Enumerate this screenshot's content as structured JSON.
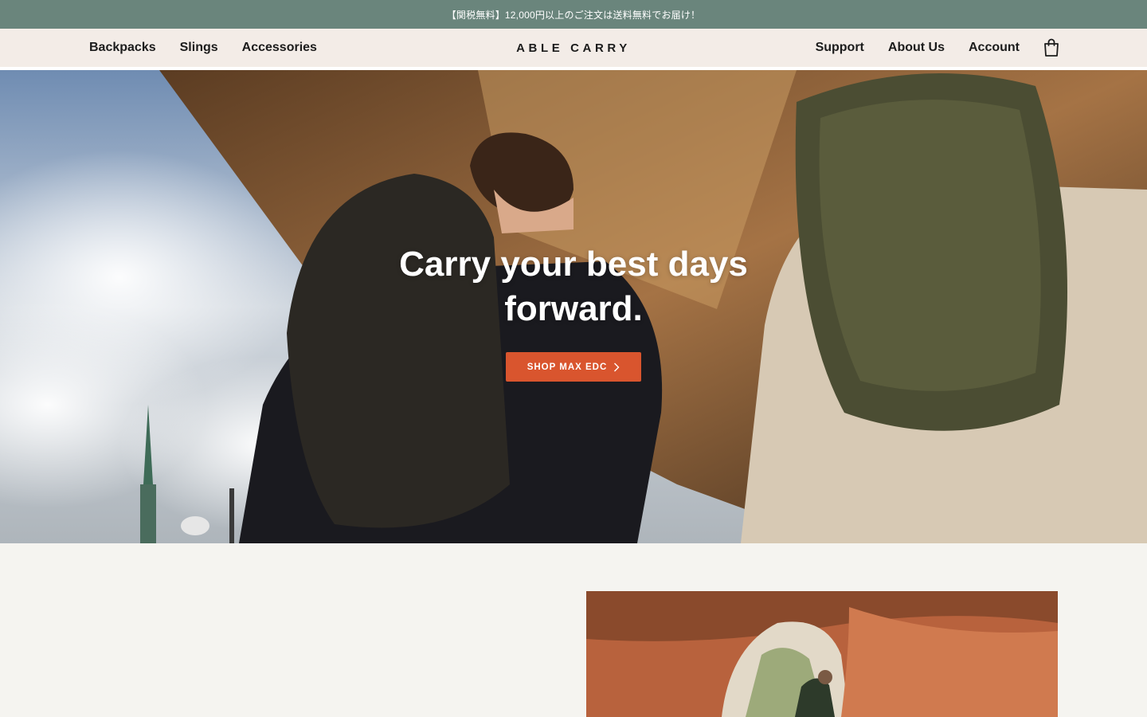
{
  "announcement": {
    "text": "【関税無料】12,000円以上のご注文は送料無料でお届け！"
  },
  "header": {
    "nav_left": [
      {
        "label": "Backpacks"
      },
      {
        "label": "Slings"
      },
      {
        "label": "Accessories"
      }
    ],
    "logo": "ABLE CARRY",
    "nav_right": [
      {
        "label": "Support"
      },
      {
        "label": "About Us"
      },
      {
        "label": "Account"
      }
    ],
    "cart_icon": "shopping-bag-icon"
  },
  "hero": {
    "title": "Carry your best days forward.",
    "cta_label": "SHOP MAX EDC",
    "cta_icon": "chevron-right-icon"
  },
  "colors": {
    "announcement_bg": "#6a857c",
    "header_bg": "#f3ece7",
    "cta_bg": "#d9552e",
    "page_bg": "#f5f4f0"
  }
}
